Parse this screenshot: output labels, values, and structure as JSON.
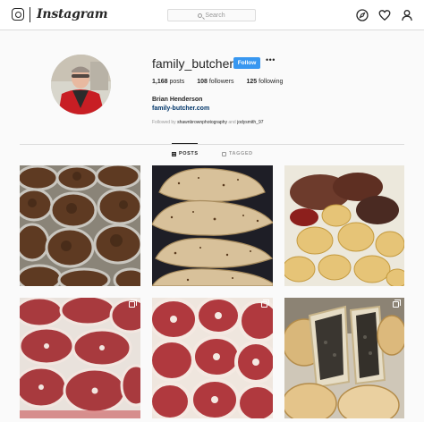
{
  "nav": {
    "wordmark": "Instagram",
    "search_placeholder": "Search",
    "icons": [
      "instagram-camera-icon",
      "compass-icon",
      "heart-icon",
      "person-icon"
    ]
  },
  "profile": {
    "username": "family_butcher1",
    "follow_label": "Follow",
    "more_label": "•••",
    "posts_count": "1,168",
    "posts_label": "posts",
    "followers_count": "108",
    "followers_label": "followers",
    "following_count": "125",
    "following_label": "following",
    "full_name": "Brian Henderson",
    "website": "family-butcher.com",
    "followed_by_prefix": "Followed by",
    "followed_by_1": "shawnbrownphotography",
    "followed_by_and": "and",
    "followed_by_2": "jodysmith_97"
  },
  "tabs": {
    "posts": "POSTS",
    "tagged": "TAGGED"
  },
  "posts": [
    {
      "subject": "trays of braised steak pie filling"
    },
    {
      "subject": "baked cornish pasties"
    },
    {
      "subject": "lamb shanks and roast potatoes"
    },
    {
      "subject": "raw lamb legs",
      "multi": true
    },
    {
      "subject": "raw lamb chops",
      "multi": true
    },
    {
      "subject": "sliced black pudding pies",
      "multi": true
    }
  ],
  "colors": {
    "accent": "#3897f0",
    "link": "#003569",
    "border": "#dbdbdb",
    "text": "#262626",
    "muted": "#999999"
  }
}
